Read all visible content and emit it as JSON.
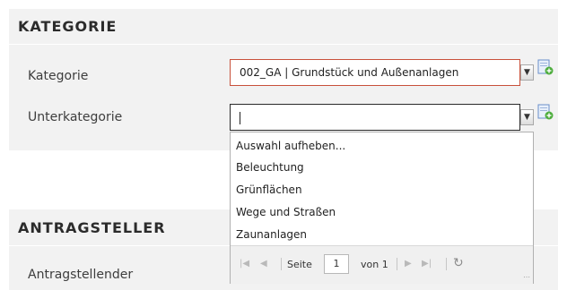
{
  "sections": {
    "kategorie": {
      "title": "KATEGORIE"
    },
    "antragsteller": {
      "title": "ANTRAGSTELLER"
    }
  },
  "fields": {
    "kategorie": {
      "label": "Kategorie",
      "value": "002_GA | Grundstück und Außenanlagen"
    },
    "unterkategorie": {
      "label": "Unterkategorie",
      "value": ""
    },
    "antragstellender": {
      "label": "Antragstellender"
    }
  },
  "dropdown": {
    "items": [
      "Auswahl aufheben...",
      "Beleuchtung",
      "Grünflächen",
      "Wege und Straßen",
      "Zaunanlagen"
    ]
  },
  "pager": {
    "page_label": "Seite",
    "current_page": "1",
    "of_label": "von 1"
  },
  "colors": {
    "panel_bg": "#f2f2f2",
    "focus_border": "#c8503a"
  },
  "icons": {
    "trigger": "chevron-down-icon",
    "add": "add-document-icon",
    "first": "first-page-icon",
    "prev": "prev-page-icon",
    "next": "next-page-icon",
    "last": "last-page-icon",
    "refresh": "refresh-icon"
  }
}
